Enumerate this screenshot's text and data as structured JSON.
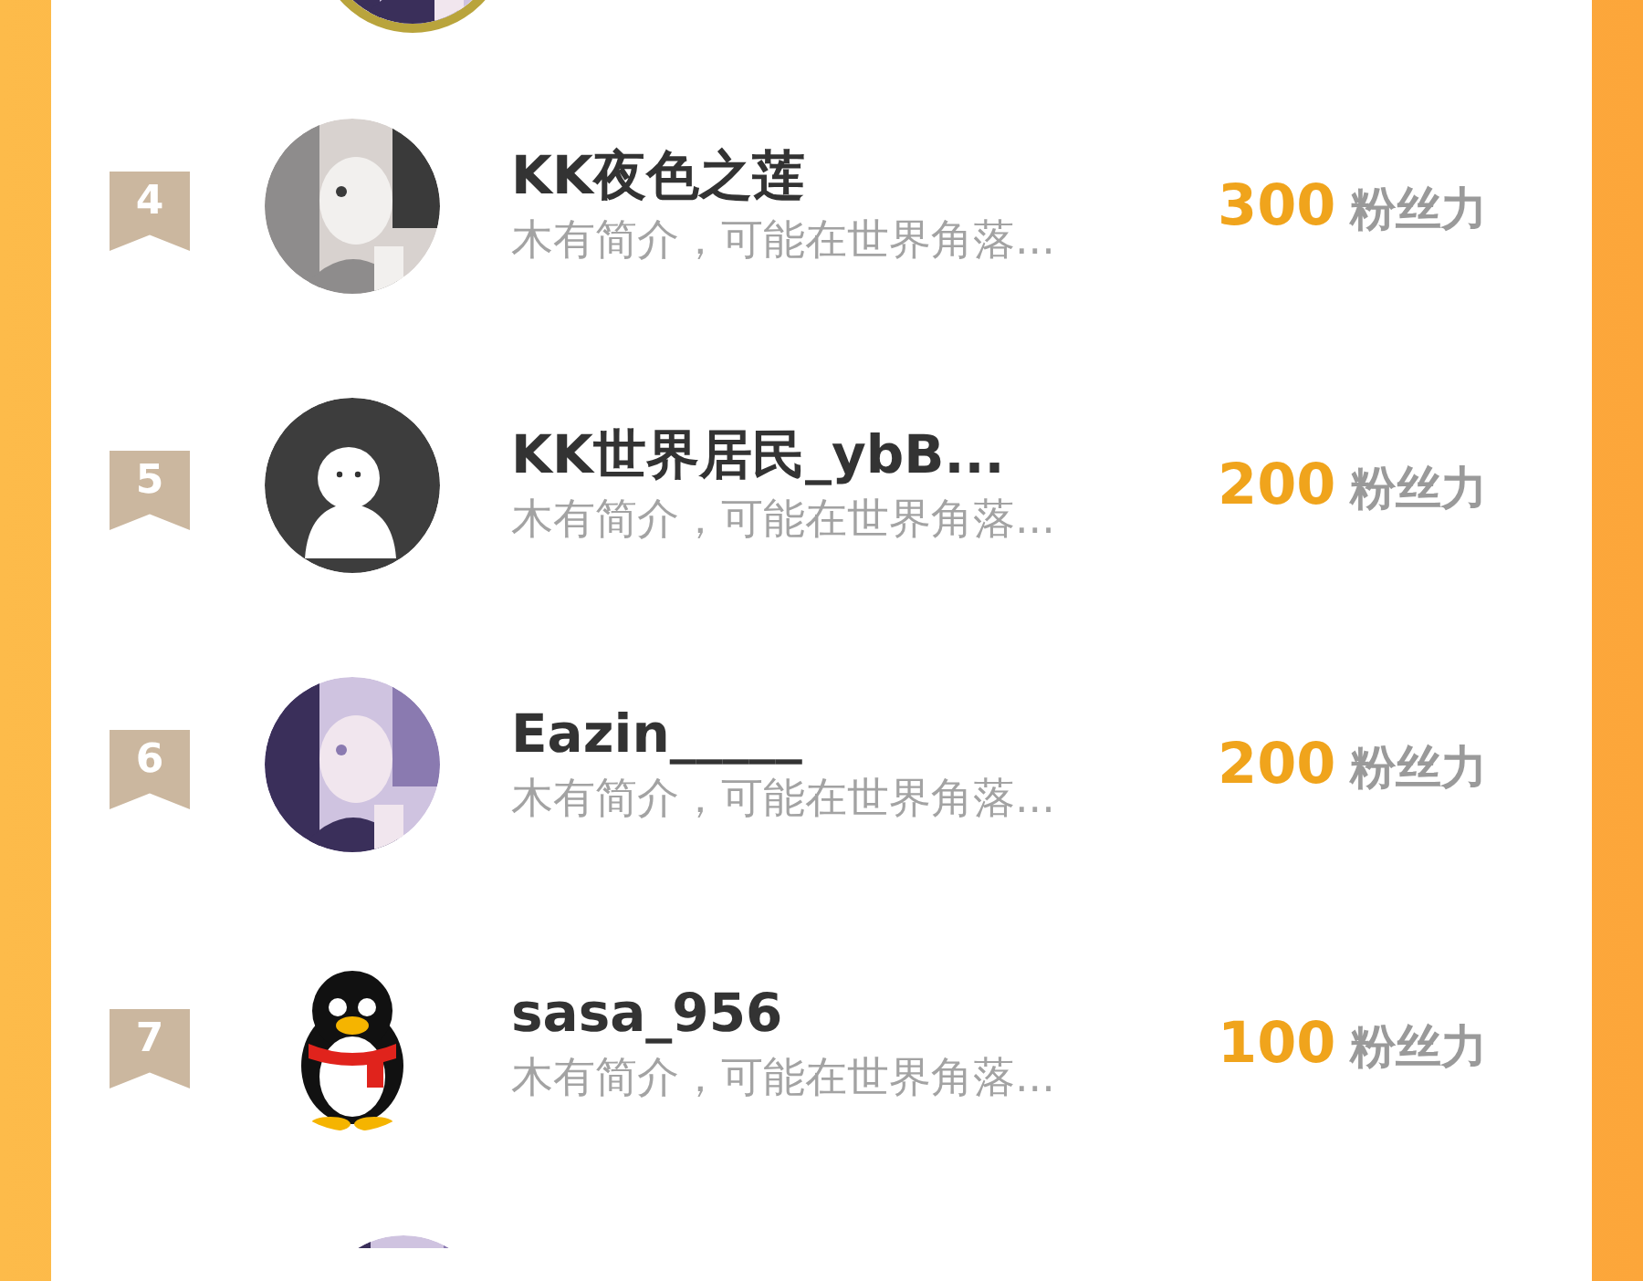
{
  "rows": [
    {
      "rank": "4",
      "name": "KK夜色之莲",
      "bio": "木有简介，可能在世界角落...",
      "score": "300",
      "unit": "粉丝力"
    },
    {
      "rank": "5",
      "kind": "default",
      "name": "KK世界居民_ybB...",
      "bio": "木有简介，可能在世界角落...",
      "score": "200",
      "unit": "粉丝力"
    },
    {
      "rank": "6",
      "name": "Eazin_____",
      "bio": "木有简介，可能在世界角落...",
      "score": "200",
      "unit": "粉丝力"
    },
    {
      "rank": "7",
      "kind": "penguin",
      "name": "sasa_956",
      "bio": "木有简介，可能在世界角落...",
      "score": "100",
      "unit": "粉丝力"
    }
  ]
}
